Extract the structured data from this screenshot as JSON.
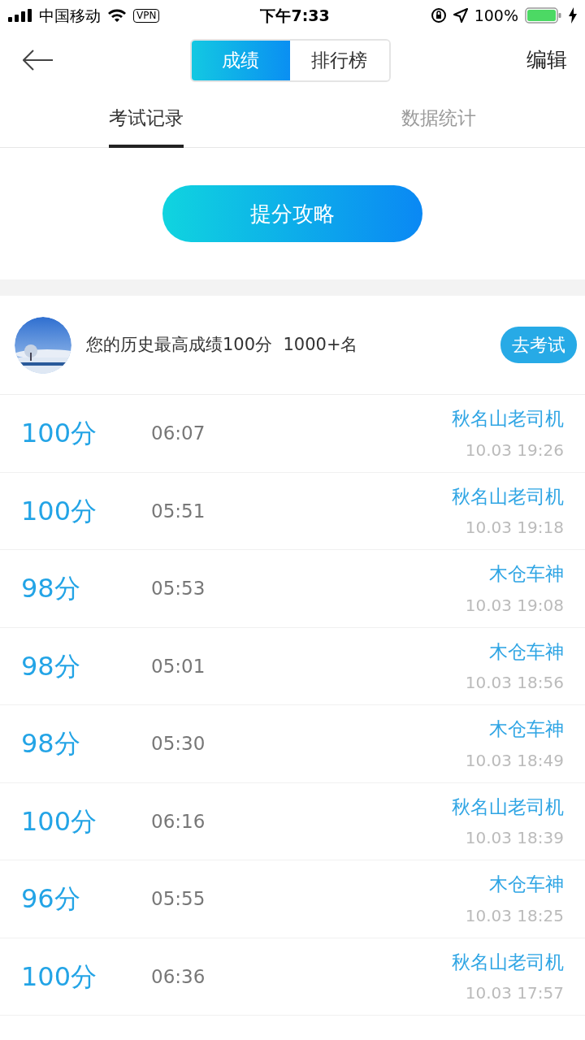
{
  "status_bar": {
    "carrier": "中国移动",
    "vpn": "VPN",
    "time": "下午7:33",
    "battery": "100%"
  },
  "header": {
    "segments": [
      {
        "label": "成绩",
        "selected": true
      },
      {
        "label": "排行榜",
        "selected": false
      }
    ],
    "action": "编辑"
  },
  "tabs": [
    {
      "label": "考试记录",
      "selected": true
    },
    {
      "label": "数据统计",
      "selected": false
    }
  ],
  "tips_button": "提分攻略",
  "best": {
    "text": "您的历史最高成绩100分  1000+名",
    "button": "去考试"
  },
  "records": [
    {
      "score": "100分",
      "duration": "06:07",
      "name": "秋名山老司机",
      "time": "10.03 19:26"
    },
    {
      "score": "100分",
      "duration": "05:51",
      "name": "秋名山老司机",
      "time": "10.03 19:18"
    },
    {
      "score": "98分",
      "duration": "05:53",
      "name": "木仓车神",
      "time": "10.03 19:08"
    },
    {
      "score": "98分",
      "duration": "05:01",
      "name": "木仓车神",
      "time": "10.03 18:56"
    },
    {
      "score": "98分",
      "duration": "05:30",
      "name": "木仓车神",
      "time": "10.03 18:49"
    },
    {
      "score": "100分",
      "duration": "06:16",
      "name": "秋名山老司机",
      "time": "10.03 18:39"
    },
    {
      "score": "96分",
      "duration": "05:55",
      "name": "木仓车神",
      "time": "10.03 18:25"
    },
    {
      "score": "100分",
      "duration": "06:36",
      "name": "秋名山老司机",
      "time": "10.03 17:57"
    }
  ]
}
